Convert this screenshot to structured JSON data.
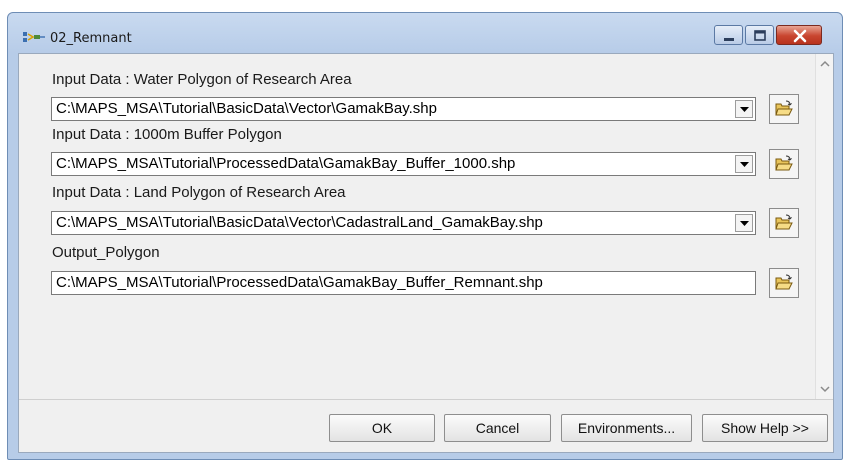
{
  "window": {
    "title": "02_Remnant"
  },
  "fields": [
    {
      "label": "Input Data : Water Polygon of Research Area",
      "value": "C:\\MAPS_MSA\\Tutorial\\BasicData\\Vector\\GamakBay.shp",
      "has_dropdown": true
    },
    {
      "label": "Input Data : 1000m Buffer Polygon",
      "value": "C:\\MAPS_MSA\\Tutorial\\ProcessedData\\GamakBay_Buffer_1000.shp",
      "has_dropdown": true
    },
    {
      "label": "Input Data : Land Polygon of Research Area",
      "value": "C:\\MAPS_MSA\\Tutorial\\BasicData\\Vector\\CadastralLand_GamakBay.shp",
      "has_dropdown": true
    },
    {
      "label": "Output_Polygon",
      "value": "C:\\MAPS_MSA\\Tutorial\\ProcessedData\\GamakBay_Buffer_Remnant.shp",
      "has_dropdown": false
    }
  ],
  "buttons": {
    "ok": "OK",
    "cancel": "Cancel",
    "environments": "Environments...",
    "show_help": "Show Help >>"
  },
  "colors": {
    "title_bar": "#b7cce8",
    "close_button": "#c8452f",
    "dialog_bg": "#f0f0f0"
  },
  "icons": [
    "tool-icon",
    "minimize-icon",
    "maximize-icon",
    "close-icon",
    "dropdown-arrow-icon",
    "open-folder-icon",
    "scroll-up-icon",
    "scroll-down-icon"
  ]
}
